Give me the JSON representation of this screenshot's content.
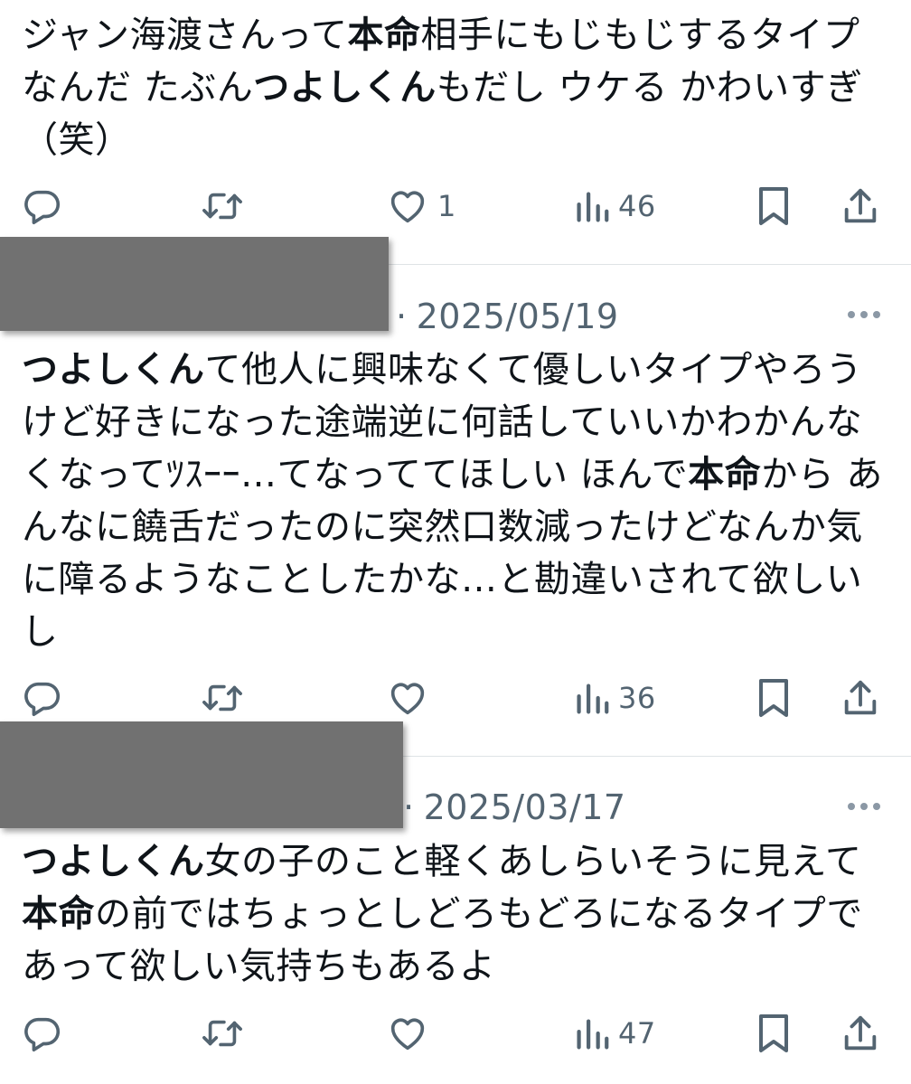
{
  "tweets": [
    {
      "text_segments": [
        {
          "t": "ジャン海渡さんって",
          "b": false
        },
        {
          "t": "本命",
          "b": true
        },
        {
          "t": "相手にもじもじするタイプなんだ たぶん",
          "b": false
        },
        {
          "t": "つよしくん",
          "b": true
        },
        {
          "t": "もだし ウケる かわいすぎ（笑）",
          "b": false
        }
      ],
      "actions": {
        "reply_count": "",
        "retweet_count": "",
        "like_count": "1",
        "views_count": "46"
      }
    },
    {
      "date": "2025/05/19",
      "date_separator": "·",
      "text_segments": [
        {
          "t": "つよしくん",
          "b": true
        },
        {
          "t": "て他人に興味なくて優しいタイプやろうけど好きになった途端逆に何話していいかわかんなくなってﾂｽｰｰ…てなっててほしい ほんで",
          "b": false
        },
        {
          "t": "本命",
          "b": true
        },
        {
          "t": "から あんなに饒舌だったのに突然口数減ったけどなんか気に障るようなことしたかな…と勘違いされて欲しいし",
          "b": false
        }
      ],
      "actions": {
        "reply_count": "",
        "retweet_count": "",
        "like_count": "",
        "views_count": "36"
      }
    },
    {
      "date": "2025/03/17",
      "date_separator": "·",
      "text_segments": [
        {
          "t": "つよしくん",
          "b": true
        },
        {
          "t": "女の子のこと軽くあしらいそうに見えて",
          "b": false
        },
        {
          "t": "本命",
          "b": true
        },
        {
          "t": "の前ではちょっとしどろもどろになるタイプであって欲しい気持ちもあるよ",
          "b": false
        }
      ],
      "actions": {
        "reply_count": "",
        "retweet_count": "",
        "like_count": "",
        "views_count": "47"
      }
    }
  ],
  "colors": {
    "text": "#0f1419",
    "secondary": "#536471",
    "divider": "#dfe3e6",
    "redaction": "#717171"
  },
  "icons": [
    "reply-icon",
    "retweet-icon",
    "like-icon",
    "views-icon",
    "bookmark-icon",
    "share-icon",
    "more-icon"
  ]
}
